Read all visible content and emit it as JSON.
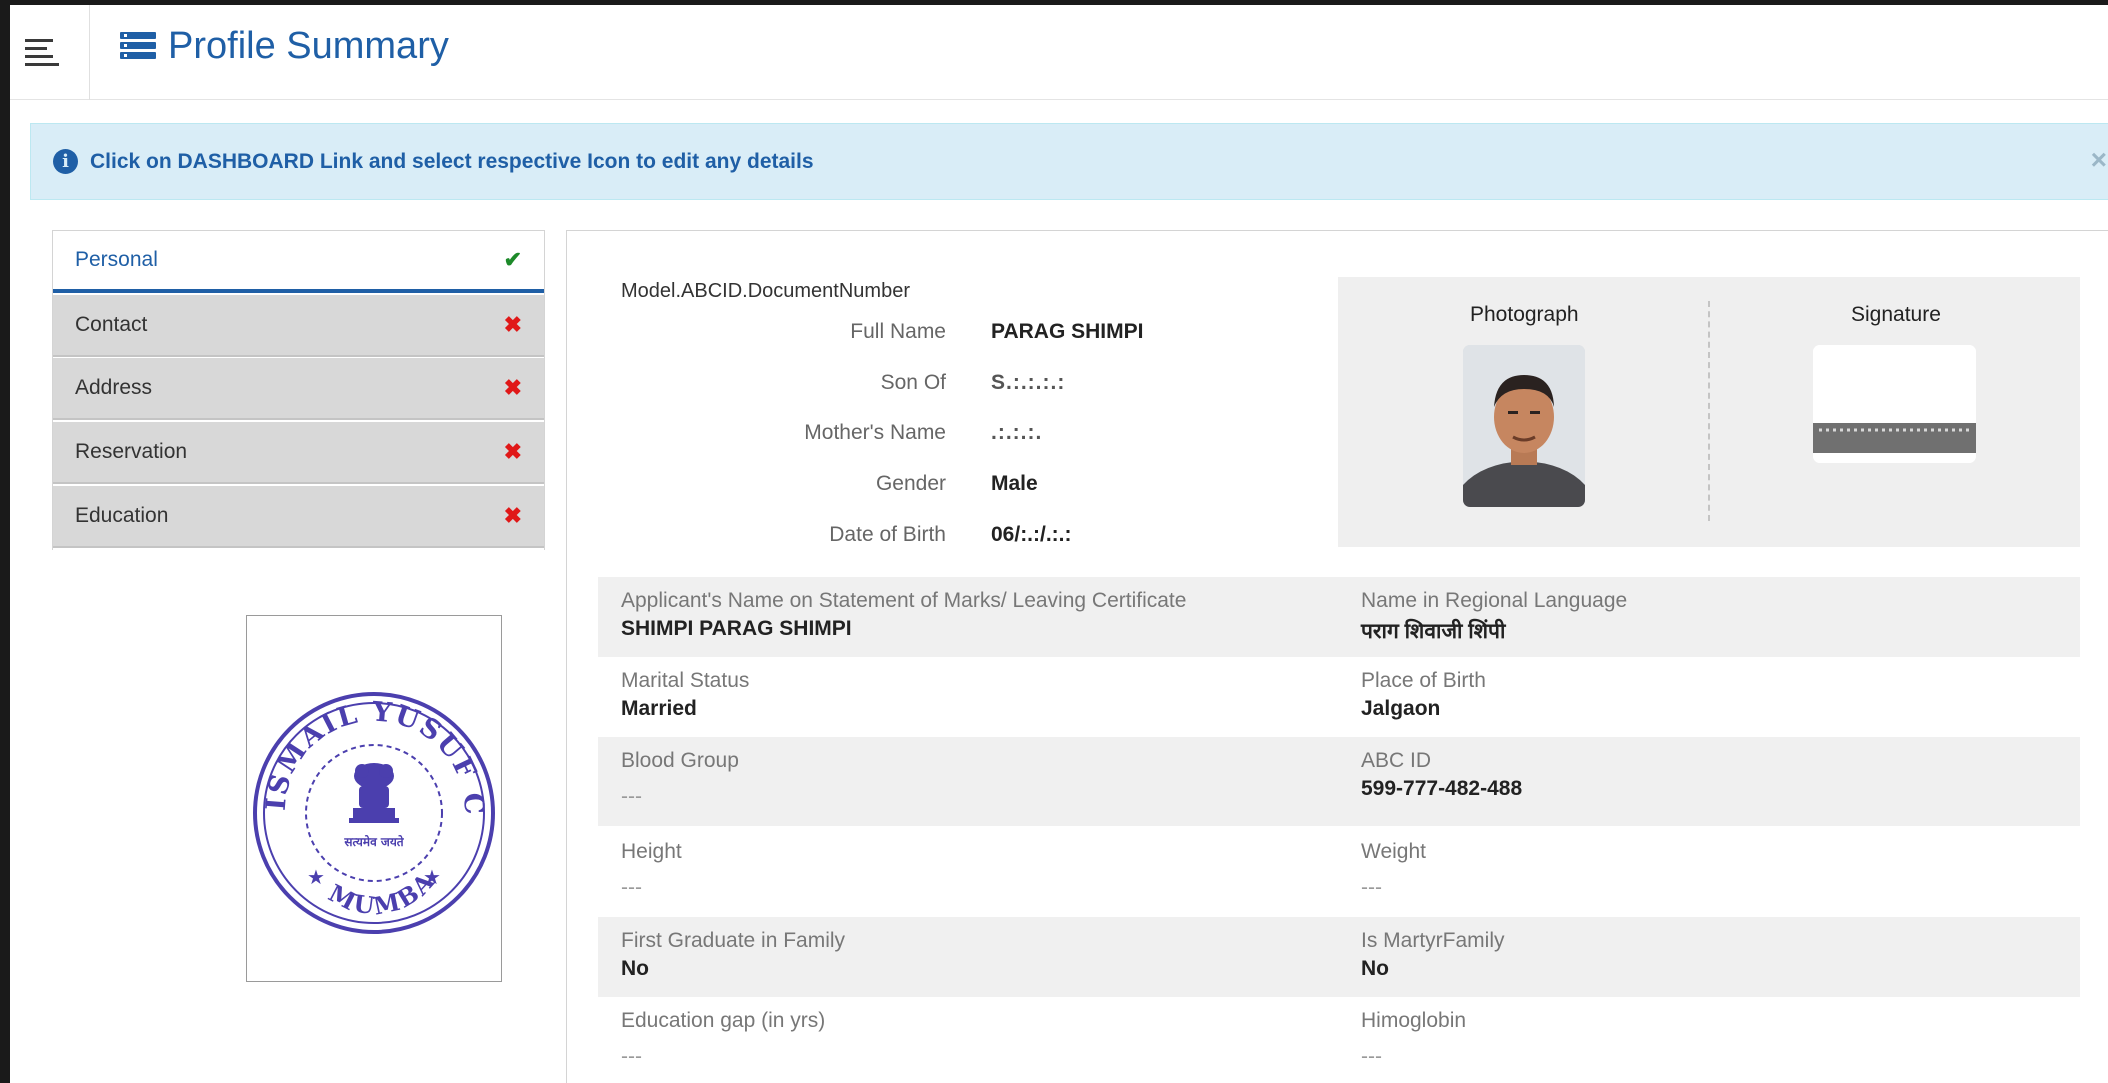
{
  "header": {
    "title": "Profile Summary"
  },
  "alert": {
    "message": "Click on DASHBOARD Link and select respective Icon to edit any details",
    "close": "×"
  },
  "tabs": [
    {
      "label": "Personal",
      "status": "✔"
    },
    {
      "label": "Contact",
      "status": "✖"
    },
    {
      "label": "Address",
      "status": "✖"
    },
    {
      "label": "Reservation",
      "status": "✖"
    },
    {
      "label": "Education",
      "status": "✖"
    }
  ],
  "seal": {
    "top_text": "ISMAIL YUSUF COLLEGE",
    "bottom_text": "MUMBAI",
    "motto": "सत्यमेव जयते"
  },
  "profile": {
    "doc_number_label": "Model.ABCID.DocumentNumber",
    "fields": [
      {
        "label": "Full Name",
        "value": "PARAG   SHIMPI"
      },
      {
        "label": "Son  Of",
        "value": "S.:.:.:.:"
      },
      {
        "label": "Mother's Name",
        "value": ".:.:.:."
      },
      {
        "label": "Gender",
        "value": "Male"
      },
      {
        "label": "Date of Birth",
        "value": "06/:.:/.:.:"
      }
    ],
    "photo_heading": "Photograph",
    "signature_heading": "Signature"
  },
  "details": [
    {
      "left_label": "Applicant's Name on Statement of Marks/ Leaving Certificate",
      "left_value": "SHIMPI PARAG SHIMPI",
      "right_label": "Name in Regional Language",
      "right_value": "पराग शिवाजी शिंपी"
    },
    {
      "left_label": "Marital Status",
      "left_value": "Married",
      "right_label": "Place of Birth",
      "right_value": "Jalgaon"
    },
    {
      "left_label": "Blood Group",
      "left_value": "---",
      "right_label": "ABC ID",
      "right_value": "599-777-482-488"
    },
    {
      "left_label": "Height",
      "left_value": "---",
      "right_label": "Weight",
      "right_value": "---"
    },
    {
      "left_label": "First Graduate in Family",
      "left_value": "No",
      "right_label": "Is MartyrFamily",
      "right_value": "No"
    },
    {
      "left_label": "Education gap (in yrs)",
      "left_value": "---",
      "right_label": "Himoglobin",
      "right_value": "---"
    }
  ],
  "colors": {
    "accent": "#1f5fa6",
    "alert_bg": "#d9edf7",
    "ok": "#1d8a2a",
    "error": "#e01818"
  }
}
